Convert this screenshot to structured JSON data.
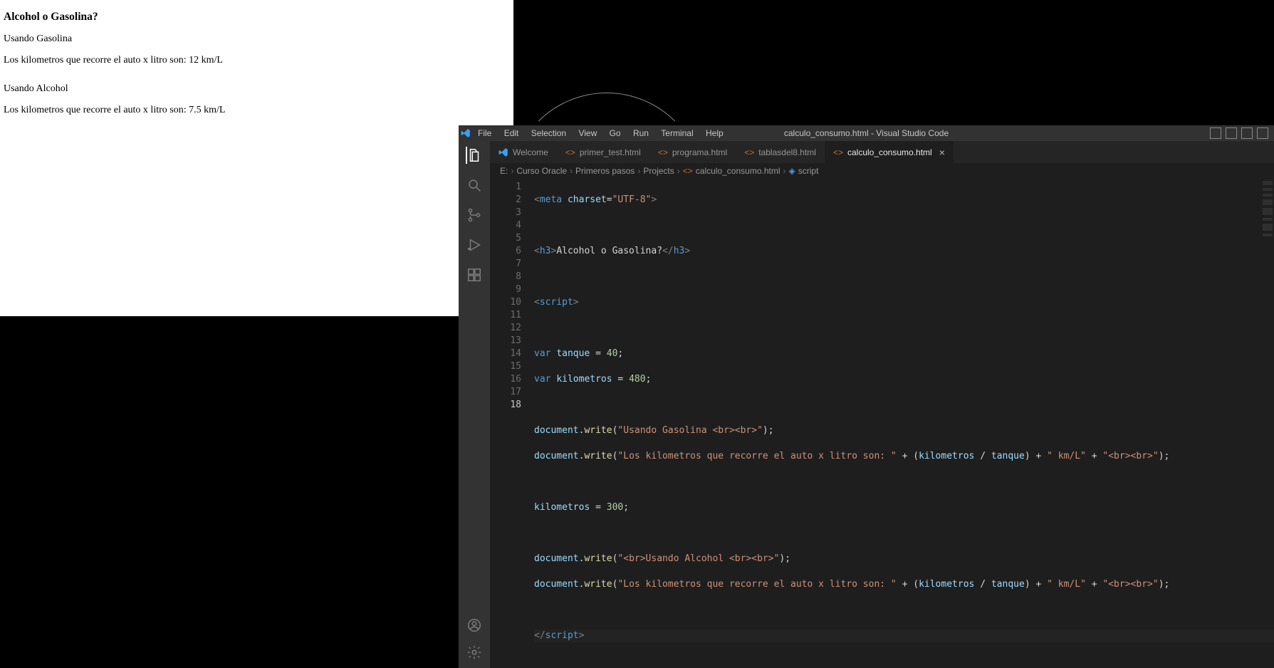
{
  "browser_page": {
    "heading": "Alcohol o Gasolina?",
    "gasolina_label": "Usando Gasolina",
    "gasolina_result": "Los kilometros que recorre el auto x litro son: 12 km/L",
    "alcohol_label": "Usando Alcohol",
    "alcohol_result": "Los kilometros que recorre el auto x litro son: 7.5 km/L"
  },
  "vscode": {
    "window_title": "calculo_consumo.html - Visual Studio Code",
    "menu": [
      "File",
      "Edit",
      "Selection",
      "View",
      "Go",
      "Run",
      "Terminal",
      "Help"
    ],
    "tabs": [
      {
        "label": "Welcome",
        "kind": "welcome",
        "active": false,
        "closeable": false
      },
      {
        "label": "primer_test.html",
        "kind": "html",
        "active": false,
        "closeable": false
      },
      {
        "label": "programa.html",
        "kind": "html",
        "active": false,
        "closeable": false
      },
      {
        "label": "tablasdel8.html",
        "kind": "html",
        "active": false,
        "closeable": false
      },
      {
        "label": "calculo_consumo.html",
        "kind": "html",
        "active": true,
        "closeable": true
      }
    ],
    "breadcrumbs": {
      "parts": [
        "E:",
        "Curso Oracle",
        "Primeros pasos",
        "Projects"
      ],
      "file": "calculo_consumo.html",
      "symbol": "script"
    },
    "code": {
      "lines": [
        1,
        2,
        3,
        4,
        5,
        6,
        7,
        8,
        9,
        10,
        11,
        12,
        13,
        14,
        15,
        16,
        17,
        18
      ],
      "current_line": 18,
      "content": {
        "l1": {
          "tag": "meta",
          "attr": "charset",
          "val": "\"UTF-8\""
        },
        "l3": {
          "open": "h3",
          "text": "Alcohol o Gasolina?",
          "close": "h3"
        },
        "l5": {
          "open": "script"
        },
        "l7": {
          "kw": "var",
          "name": "tanque",
          "val": "40"
        },
        "l8": {
          "kw": "var",
          "name": "kilometros",
          "val": "480"
        },
        "l10": {
          "obj": "document",
          "fn": "write",
          "arg": "\"Usando Gasolina <br><br>\""
        },
        "l11": {
          "obj": "document",
          "fn": "write",
          "arg1": "\"Los kilometros que recorre el auto x litro son: \"",
          "v1": "kilometros",
          "v2": "tanque",
          "arg2": "\" km/L\"",
          "arg3": "\"<br><br>\""
        },
        "l13": {
          "name": "kilometros",
          "val": "300"
        },
        "l15": {
          "obj": "document",
          "fn": "write",
          "arg": "\"<br>Usando Alcohol <br><br>\""
        },
        "l16": {
          "obj": "document",
          "fn": "write",
          "arg1": "\"Los kilometros que recorre el auto x litro son: \"",
          "v1": "kilometros",
          "v2": "tanque",
          "arg2": "\" km/L\"",
          "arg3": "\"<br><br>\""
        },
        "l18": {
          "close": "script"
        }
      }
    }
  }
}
